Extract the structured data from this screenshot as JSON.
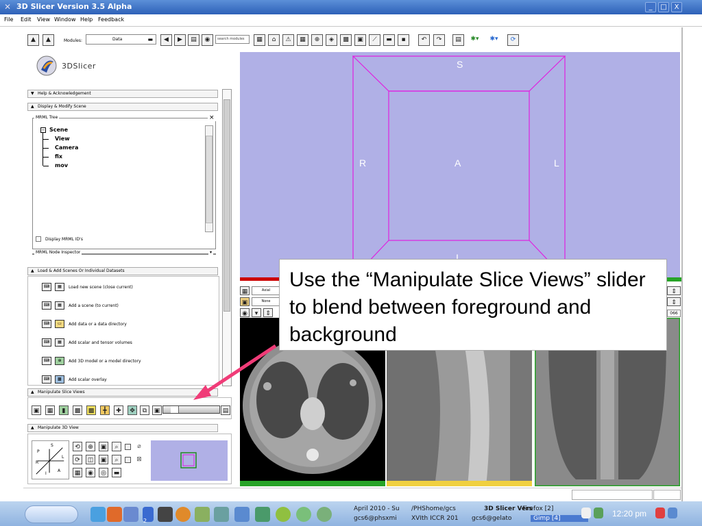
{
  "window": {
    "title": "3D Slicer Version 3.5 Alpha",
    "buttons": [
      "_",
      "□",
      "X"
    ]
  },
  "menu": [
    "File",
    "Edit",
    "View",
    "Window",
    "Help",
    "Feedback"
  ],
  "toolbar": {
    "modules_label": "Modules:",
    "modules_value": "Data",
    "search_placeholder": "search modules"
  },
  "app_logo_text": "3DSlicer",
  "sections": {
    "help": "Help & Acknowledgement",
    "display": "Display & Modify Scene",
    "load": "Load & Add Scenes Or Individual Datasets",
    "manip_slice": "Manipulate Slice Views",
    "manip_3d": "Manipulate 3D View"
  },
  "mrml_tree": {
    "title": "MRML Tree",
    "close": "×",
    "items": [
      "Scene",
      "View",
      "Camera",
      "fix",
      "mov"
    ],
    "display_ids_label": "Display MRML ID's",
    "node_inspector": "MRML Node Inspector"
  },
  "load_rows": [
    "Load new scene (close current)",
    "Add a scene (to current)",
    "Add data or a data directory",
    "Add scalar and tensor volumes",
    "Add 3D model or a model directory",
    "Add scalar overlay"
  ],
  "view3d_labels": {
    "top": "S",
    "left": "R",
    "center": "A",
    "right": "L",
    "bottom": "I"
  },
  "axis_widget_labels": {
    "p": "P",
    "s": "S",
    "l": "L",
    "r": "R",
    "i": "I",
    "a": "A"
  },
  "slice_controls": {
    "orientation": "Axial",
    "layer": "None",
    "right_value": "066"
  },
  "slice_views": {
    "fill_color": "#000000"
  },
  "callout": {
    "text": "Use the “Manipulate Slice Views” slider to blend between foreground and background"
  },
  "slider": {
    "blend_value": 0.15
  },
  "taskbar": {
    "tasks_row1": [
      "April 2010 - Su",
      "/PHShome/gcs",
      "3D Slicer Vers",
      "Firefox [2]"
    ],
    "tasks_row2": [
      "gcs6@phsxmi",
      "XVIth ICCR 201",
      "gcs6@gelato",
      "Gimp [4]"
    ],
    "clock": "12:20 pm",
    "workspace": "2"
  },
  "colors": {
    "view_bg": "#b0b0e6",
    "bbox": "#e020e0",
    "arrow": "#f03c78",
    "title_bar": "#2e61b8"
  }
}
